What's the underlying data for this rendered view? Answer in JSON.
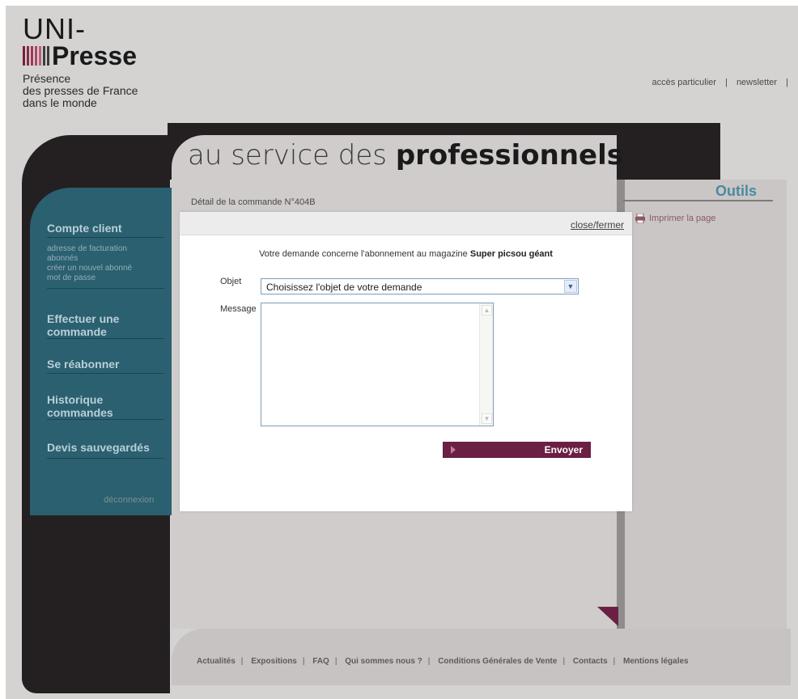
{
  "logo": {
    "line1": "UNI-",
    "line2": "Presse",
    "tagline": [
      "Présence",
      "des presses de France",
      "dans le monde"
    ],
    "bar_colors": [
      "#7a1f3d",
      "#8a2a4b",
      "#9b3656",
      "#ad4566",
      "#c05c7a",
      "#3d3d3d",
      "#3d3d3d"
    ]
  },
  "header": {
    "links": [
      "accès particulier",
      "newsletter"
    ],
    "separator": "|",
    "headline_light": "au service des",
    "headline_bold": "professionnels"
  },
  "main": {
    "detail_title": "Détail de la commande N°404B"
  },
  "sidebar": {
    "compte_client": "Compte client",
    "sub_items": [
      "adresse de facturation",
      "abonnés",
      "créer un nouvel abonné",
      "mot de passe"
    ],
    "effectuer_1": "Effectuer une",
    "effectuer_2": "commande",
    "reabonner": "Se réabonner",
    "historique_1": "Historique",
    "historique_2": "commandes",
    "devis": "Devis sauvegardés",
    "deconnexion": "déconnexion"
  },
  "tools": {
    "title": "Outils",
    "print_label": "Imprimer la page"
  },
  "footer": {
    "links": [
      "Actualités",
      "Expositions",
      "FAQ",
      "Qui sommes nous ?",
      "Conditions Générales de Vente",
      "Contacts",
      "Mentions légales"
    ],
    "separator": "|"
  },
  "modal": {
    "close_label": "close/fermer",
    "intro_text": "Votre demande concerne l'abonnement au magazine",
    "magazine": "Super picsou géant",
    "objet_label": "Objet",
    "objet_value": "Choisissez l'objet de votre demande",
    "message_label": "Message",
    "send_label": "Envoyer"
  },
  "colors": {
    "accent": "#6a1f43",
    "teal": "#2a6070",
    "dark": "#242021"
  }
}
